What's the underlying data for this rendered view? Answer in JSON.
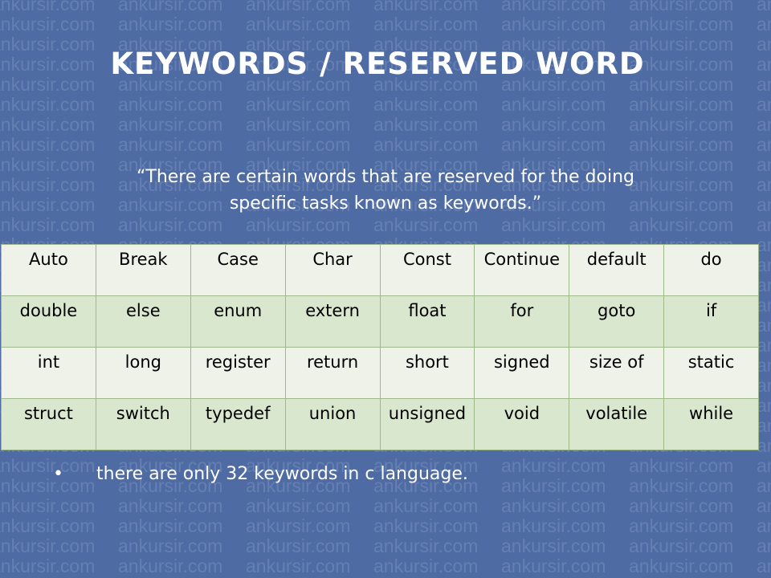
{
  "slide": {
    "title": "KEYWORDS / RESERVED WORD",
    "quote_line1": "“There are certain words that are reserved for the doing",
    "quote_line2": "specific tasks known as keywords.”",
    "watermark": "ankursir.com"
  },
  "keywords": {
    "rows": [
      [
        "Auto",
        "Break",
        "Case",
        "Char",
        "Const",
        "Continue",
        "default",
        "do"
      ],
      [
        "double",
        "else",
        "enum",
        "extern",
        "float",
        "for",
        "goto",
        "if"
      ],
      [
        "int",
        "long",
        "register",
        "return",
        "short",
        "signed",
        "size of",
        "static"
      ],
      [
        "struct",
        "switch",
        "typedef",
        "union",
        "unsigned",
        "void",
        "volatile",
        "while"
      ]
    ]
  },
  "bullet": {
    "marker": "•",
    "text": "there are only 32 keywords in c language."
  },
  "colors": {
    "background": "#4f6ba3",
    "table_row_light": "#eef2e8",
    "table_row_dark": "#d9e7cf",
    "text": "#ffffff"
  }
}
